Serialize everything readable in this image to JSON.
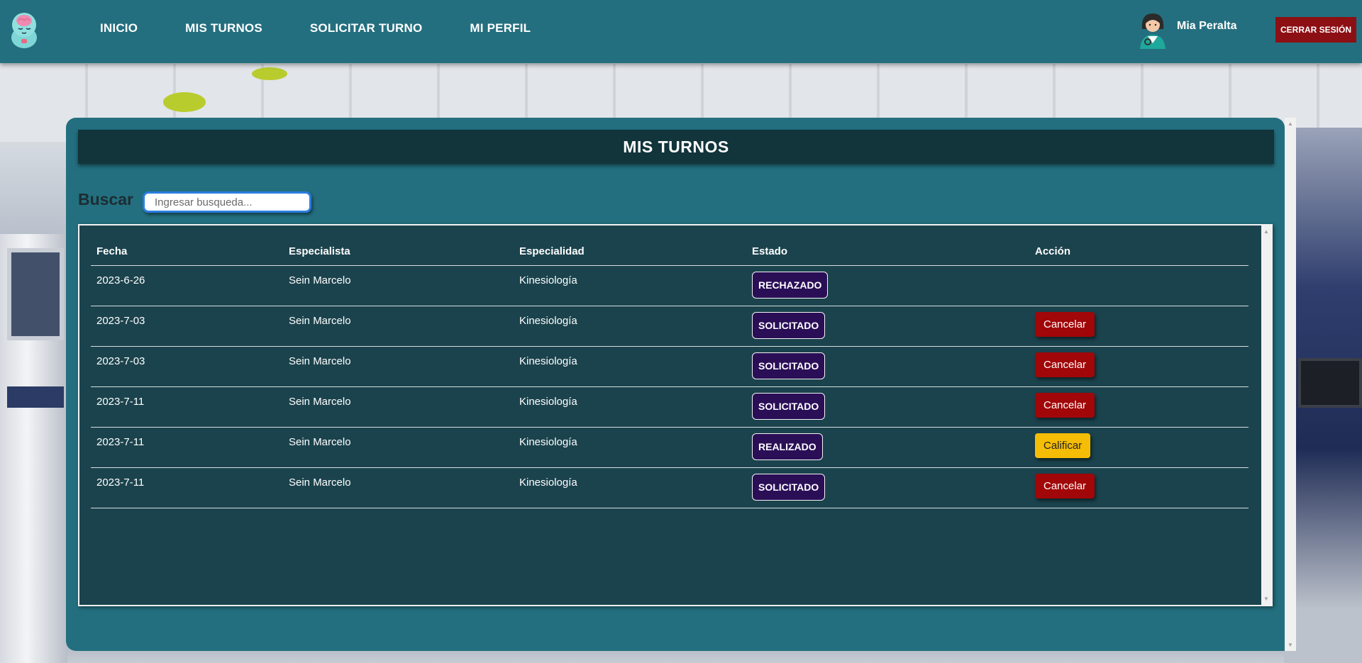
{
  "nav": {
    "links": [
      "INICIO",
      "MIS TURNOS",
      "SOLICITAR TURNO",
      "MI PERFIL"
    ],
    "user_name": "Mia Peralta",
    "logout_label": "CERRAR SESIÓN"
  },
  "page": {
    "title": "MIS TURNOS",
    "search_label": "Buscar",
    "search_placeholder": "Ingresar busqueda..."
  },
  "table": {
    "headers": [
      "Fecha",
      "Especialista",
      "Especialidad",
      "Estado",
      "Acción"
    ],
    "rows": [
      {
        "fecha": "2023-6-26",
        "especialista": "Sein Marcelo",
        "especialidad": "Kinesiología",
        "estado": "RECHAZADO",
        "accion": ""
      },
      {
        "fecha": "2023-7-03",
        "especialista": "Sein Marcelo",
        "especialidad": "Kinesiología",
        "estado": "SOLICITADO",
        "accion": "Cancelar"
      },
      {
        "fecha": "2023-7-03",
        "especialista": "Sein Marcelo",
        "especialidad": "Kinesiología",
        "estado": "SOLICITADO",
        "accion": "Cancelar"
      },
      {
        "fecha": "2023-7-11",
        "especialista": "Sein Marcelo",
        "especialidad": "Kinesiología",
        "estado": "SOLICITADO",
        "accion": "Cancelar"
      },
      {
        "fecha": "2023-7-11",
        "especialista": "Sein Marcelo",
        "especialidad": "Kinesiología",
        "estado": "REALIZADO",
        "accion": "Calificar"
      },
      {
        "fecha": "2023-7-11",
        "especialista": "Sein Marcelo",
        "especialidad": "Kinesiología",
        "estado": "SOLICITADO",
        "accion": "Cancelar"
      }
    ]
  },
  "colors": {
    "nav_bg": "#246f7f",
    "panel_bg": "#236f7f",
    "title_bar_bg": "#12343b",
    "table_bg": "#1b434d",
    "badge_bg": "#2a0f57",
    "cancel_bg": "#a10608",
    "rate_bg": "#f5bd05",
    "logout_bg": "#8c0f14"
  },
  "icons": {
    "logo": "brain-mascot-icon",
    "avatar": "doctor-woman-avatar-icon"
  }
}
